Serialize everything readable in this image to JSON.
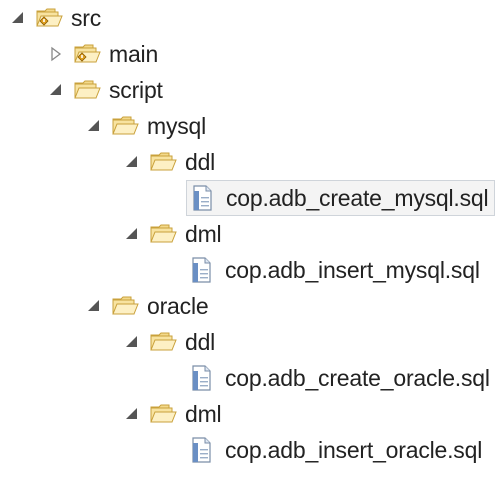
{
  "tree": {
    "src": "src",
    "main": "main",
    "script": "script",
    "mysql": "mysql",
    "mysql_ddl": "ddl",
    "mysql_ddl_file": "cop.adb_create_mysql.sql",
    "mysql_dml": "dml",
    "mysql_dml_file": "cop.adb_insert_mysql.sql",
    "oracle": "oracle",
    "oracle_ddl": "ddl",
    "oracle_ddl_file": "cop.adb_create_oracle.sql",
    "oracle_dml": "dml",
    "oracle_dml_file": "cop.adb_insert_oracle.sql"
  },
  "colors": {
    "folder_fill": "#f8e3a0",
    "folder_stroke": "#c9a13b",
    "package_badge": "#e0a020",
    "file_accent": "#6a8fc4",
    "twisty": "#555555",
    "selection": "#f4f4f4"
  },
  "icons": {
    "expanded": "triangle-down-icon",
    "collapsed": "triangle-right-icon",
    "folder": "open-folder-icon",
    "source_folder": "source-folder-icon",
    "sql_file": "sql-file-icon"
  }
}
